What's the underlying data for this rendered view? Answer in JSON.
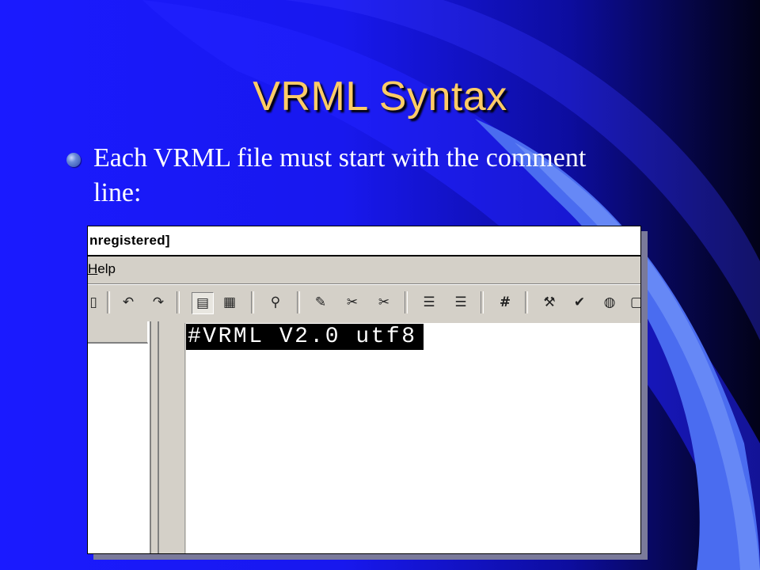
{
  "slide": {
    "title": "VRML Syntax",
    "bullet": "Each VRML file must start with the comment line:",
    "colors": {
      "background": "#1a1aff",
      "title": "#ffcc66",
      "text": "#ffffff"
    }
  },
  "screenshot": {
    "window_title": "nregistered]",
    "menu": {
      "help_label": "Help",
      "help_mnemonic": "H",
      "help_rest": "elp"
    },
    "toolbar_icons": [
      "print-icon",
      "undo-icon",
      "redo-icon",
      "view-tree-icon",
      "view-props-icon",
      "find-icon",
      "marker-icon",
      "cut-node-icon",
      "copy-node-icon",
      "outdent-icon",
      "indent-icon",
      "hash-icon",
      "build-icon",
      "check-icon",
      "globe-icon",
      "preview-icon"
    ],
    "editor": {
      "first_line": "#VRML V2.0 utf8"
    }
  }
}
